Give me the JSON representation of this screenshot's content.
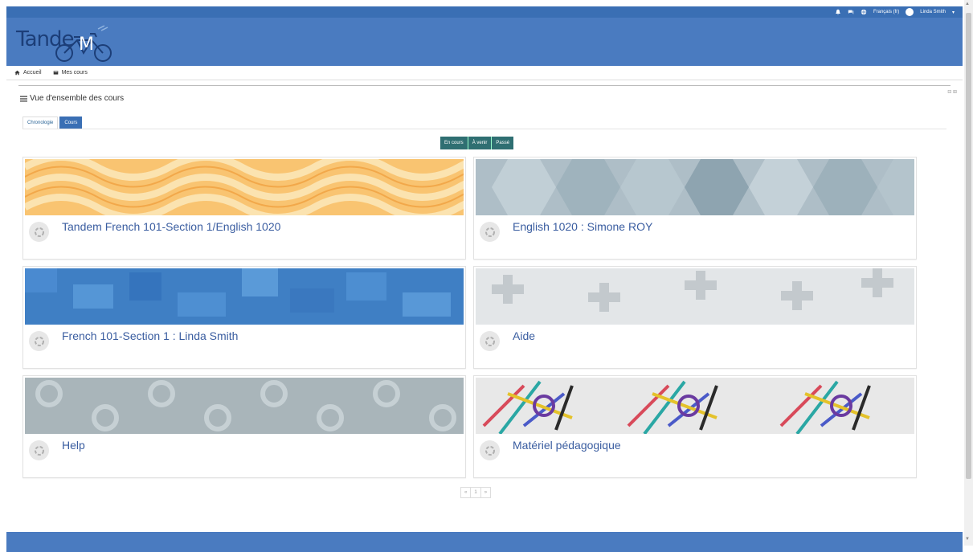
{
  "topbar": {
    "language": "Français (fr)",
    "user_name": "Linda Smith",
    "caret": "▾"
  },
  "header": {
    "logo_text": "Tande"
  },
  "nav": {
    "home": "Accueil",
    "my_courses": "Mes cours"
  },
  "block": {
    "title": "Vue d'ensemble des cours",
    "control": "⊟ ⊞",
    "tabs": [
      {
        "label": "Chronologie"
      },
      {
        "label": "Cours"
      }
    ],
    "filters": [
      {
        "label": "En cours"
      },
      {
        "label": "À venir"
      },
      {
        "label": "Passé"
      }
    ]
  },
  "courses": [
    {
      "title": "Tandem French 101-Section 1/English 1020"
    },
    {
      "title": "English 1020 : Simone ROY"
    },
    {
      "title": "French 101-Section 1 : Linda Smith"
    },
    {
      "title": "Aide"
    },
    {
      "title": "Help"
    },
    {
      "title": "Matériel pédagogique"
    }
  ],
  "pager": {
    "prev": "«",
    "page": "1",
    "next": "»"
  },
  "colors": {
    "brand": "#4a7bc0",
    "topbar": "#3a6fb4",
    "filter": "#2f6f72",
    "link": "#3a5da0"
  }
}
